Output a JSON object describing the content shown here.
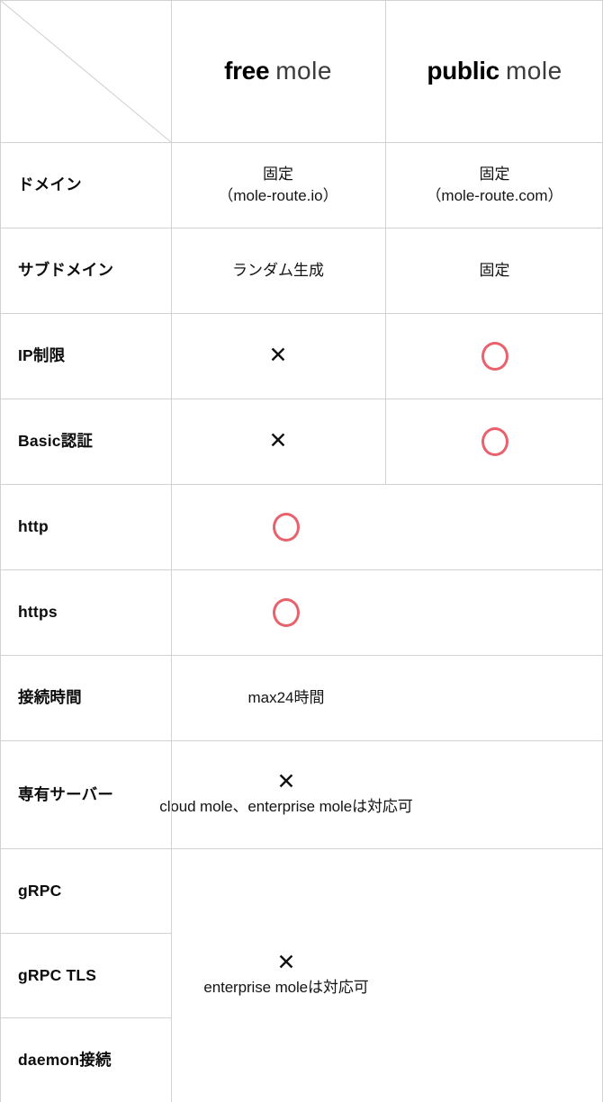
{
  "table": {
    "corner": {
      "diagonal_icon": "diagonal-slash"
    },
    "columns": [
      {
        "strong": "free",
        "light": "mole"
      },
      {
        "strong": "public",
        "light": "mole"
      }
    ],
    "accent_color": "#e8616c",
    "grid_color": "#d2d2d2",
    "rows": [
      {
        "label": "ドメイン",
        "free": {
          "line1": "固定",
          "line2": "（mole-route.io）"
        },
        "public": {
          "line1": "固定",
          "line2": "（mole-route.com）"
        }
      },
      {
        "label": "サブドメイン",
        "free": {
          "line1": "ランダム生成"
        },
        "public": {
          "line1": "固定"
        }
      },
      {
        "label": "IP制限",
        "free": {
          "mark": "✕"
        },
        "public": {
          "mark": "circle"
        }
      },
      {
        "label": "Basic認証",
        "free": {
          "mark": "✕"
        },
        "public": {
          "mark": "circle"
        }
      },
      {
        "label": "http",
        "merged": {
          "mark": "circle"
        }
      },
      {
        "label": "https",
        "merged": {
          "mark": "circle"
        }
      },
      {
        "label": "接続時間",
        "merged": {
          "text": "max24時間"
        }
      },
      {
        "label": "専有サーバー",
        "merged": {
          "mark": "✕",
          "caption": "cloud mole、enterprise moleは対応可"
        }
      },
      {
        "label": "gRPC"
      },
      {
        "label": "gRPC TLS"
      },
      {
        "label": "daemon接続"
      }
    ],
    "grpc_group": {
      "mark": "✕",
      "caption": "enterprise moleは対応可"
    }
  }
}
